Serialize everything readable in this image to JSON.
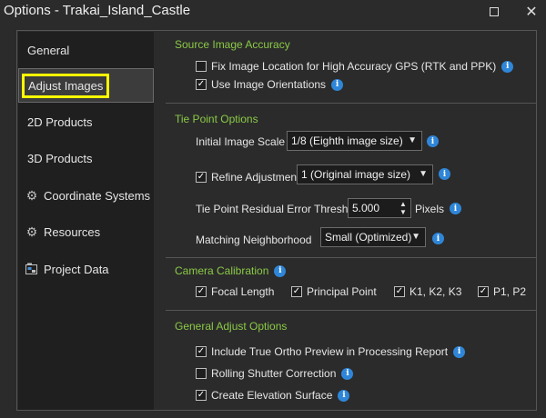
{
  "window": {
    "title": "Options - Trakai_Island_Castle",
    "maximize_icon": "maximize-icon",
    "close_icon": "close-icon"
  },
  "sidebar": {
    "items": [
      {
        "label": "General"
      },
      {
        "label": "Adjust Images"
      },
      {
        "label": "2D Products"
      },
      {
        "label": "3D Products"
      },
      {
        "label": "Coordinate Systems",
        "icon": "gear-icon"
      },
      {
        "label": "Resources",
        "icon": "gear-icon"
      },
      {
        "label": "Project Data",
        "icon": "project-data-icon"
      }
    ],
    "selected": "Adjust Images"
  },
  "source_image_accuracy": {
    "title": "Source Image Accuracy",
    "fix_location": {
      "label": "Fix Image Location for High Accuracy GPS (RTK and PPK)",
      "checked": false
    },
    "use_orientations": {
      "label": "Use Image Orientations",
      "checked": true
    }
  },
  "tie_point_options": {
    "title": "Tie Point Options",
    "initial_scale": {
      "label": "Initial Image Scale",
      "value": "1/8 (Eighth image size)"
    },
    "refine_adjustment": {
      "label": "Refine Adjustment",
      "checked": true,
      "value": "1 (Original image size)"
    },
    "residual_threshold": {
      "label": "Tie Point Residual Error Threshold",
      "value": "5.000",
      "unit": "Pixels"
    },
    "matching_neighborhood": {
      "label": "Matching Neighborhood",
      "value": "Small (Optimized)"
    }
  },
  "camera_calibration": {
    "title": "Camera Calibration",
    "focal_length": {
      "label": "Focal Length",
      "checked": true
    },
    "principal_point": {
      "label": "Principal Point",
      "checked": true
    },
    "k_params": {
      "label": "K1, K2, K3",
      "checked": true
    },
    "p_params": {
      "label": "P1, P2",
      "checked": true
    }
  },
  "general_adjust_options": {
    "title": "General Adjust Options",
    "true_ortho_preview": {
      "label": "Include True Ortho Preview in Processing Report",
      "checked": true
    },
    "rolling_shutter": {
      "label": "Rolling Shutter Correction",
      "checked": false
    },
    "elevation_surface": {
      "label": "Create Elevation Surface",
      "checked": true
    }
  },
  "glyphs": {
    "check": "✓",
    "info": "i",
    "chevron": "▼",
    "up": "▲",
    "down": "▼",
    "gear": "⚙"
  },
  "colors": {
    "section_title": "#8ac946",
    "info_icon": "#2f86d8",
    "highlight": "#ffff00",
    "background": "#2b2b2b",
    "sidebar": "#1f1f1f"
  }
}
